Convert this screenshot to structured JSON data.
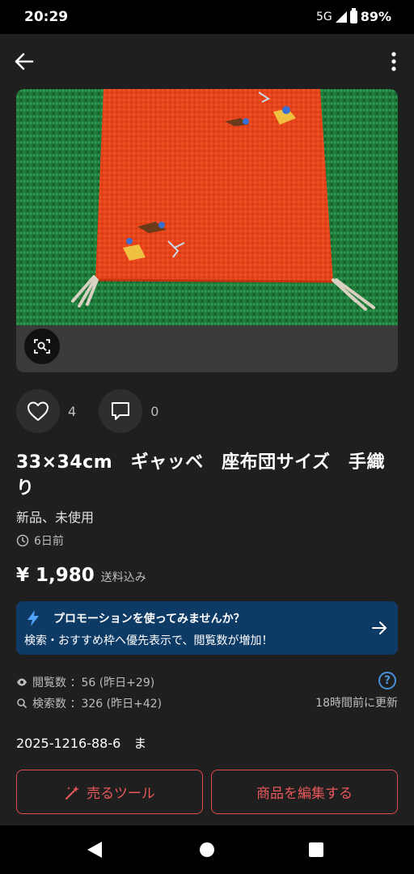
{
  "status_bar": {
    "time": "20:29",
    "network": "5G",
    "battery": "89%"
  },
  "app_bar": {
    "back_icon": "arrow-left-icon",
    "more_icon": "more-vertical-icon"
  },
  "image": {
    "lens_icon": "image-search-icon"
  },
  "reactions": {
    "likes": "4",
    "comments": "0"
  },
  "item": {
    "title": "33×34cm　ギャッベ　座布団サイズ　手織り",
    "condition": "新品、未使用",
    "posted": "6日前",
    "price": "¥ 1,980",
    "shipping": "送料込み"
  },
  "promo": {
    "title": "プロモーションを使ってみませんか？",
    "subtitle": "検索・おすすめ枠へ優先表示で、閲覧数が増加！"
  },
  "stats": {
    "views": "閲覧数 ：56 (昨日+29)",
    "searches": "検索数 ：326 (昨日+42)",
    "updated": "18時間前に更新",
    "help": "?"
  },
  "item_code": "2025-1216-88-6　ま",
  "actions": {
    "sell_tool": "売るツール",
    "edit": "商品を編集する"
  },
  "colors": {
    "accent": "#e04a4a",
    "promo_bg": "#0e3a66",
    "background": "#1f1f1f",
    "link": "#4a90d9"
  }
}
